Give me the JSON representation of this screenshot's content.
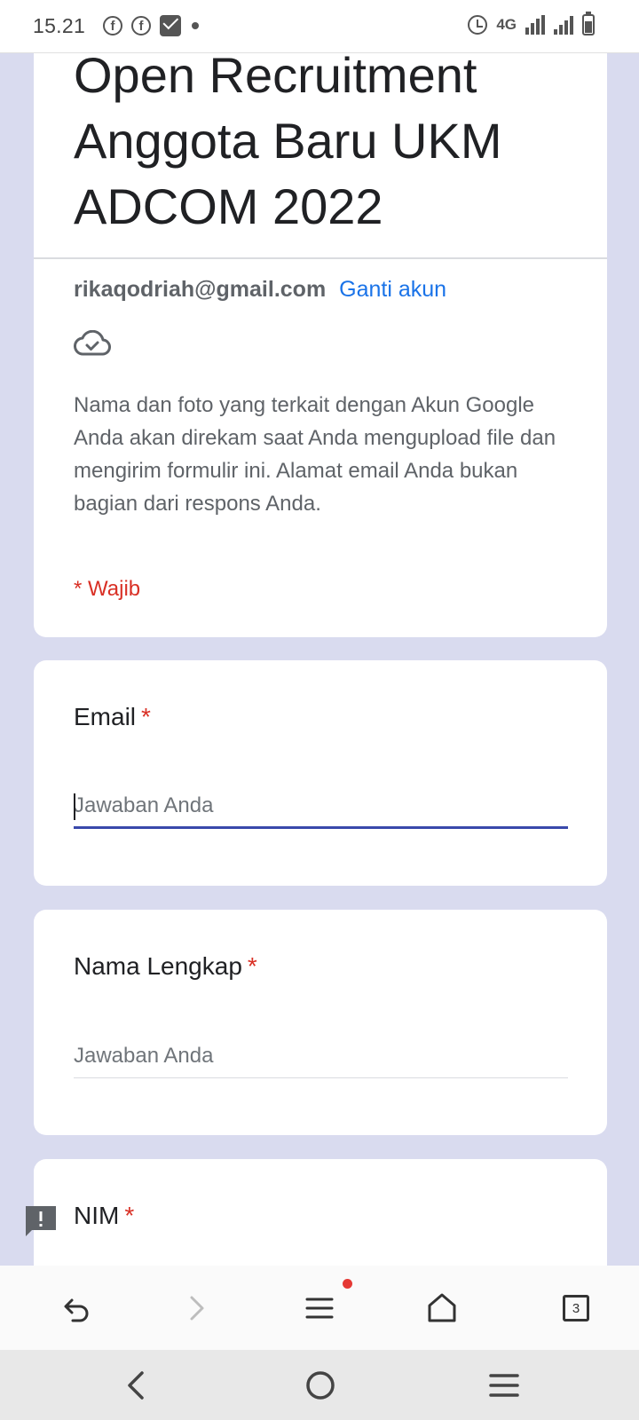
{
  "status_bar": {
    "time": "15.21",
    "network": "4G",
    "left_icons": [
      "facebook-icon",
      "facebook-icon",
      "mail-icon",
      "dot-icon"
    ],
    "right_icons": [
      "alarm-icon",
      "signal-icon",
      "signal-icon",
      "battery-icon"
    ]
  },
  "form": {
    "title": "Open Recruitment Anggota Baru UKM ADCOM 2022",
    "account_email": "rikaqodriah@gmail.com",
    "switch_account_label": "Ganti akun",
    "notice": "Nama dan foto yang terkait dengan Akun Google Anda akan direkam saat Anda mengupload file dan mengirim formulir ini. Alamat email Anda bukan bagian dari respons Anda.",
    "required_note": "* Wajib",
    "questions": [
      {
        "label": "Email",
        "required_mark": "*",
        "placeholder": "Jawaban Anda",
        "value": ""
      },
      {
        "label": "Nama Lengkap",
        "required_mark": "*",
        "placeholder": "Jawaban Anda",
        "value": ""
      },
      {
        "label": "NIM",
        "required_mark": "*"
      }
    ]
  },
  "browser_toolbar": {
    "tab_count": "3"
  },
  "colors": {
    "background": "#d9dbef",
    "accent": "#3949ab",
    "link": "#1a73e8",
    "required": "#d93025"
  }
}
